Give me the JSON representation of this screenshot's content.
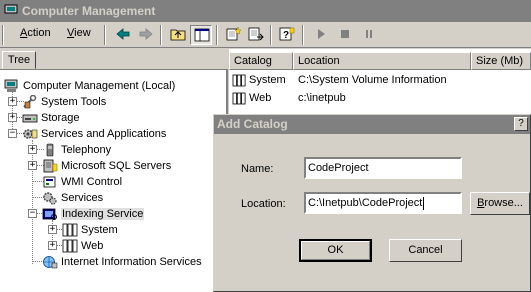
{
  "window": {
    "title": "Computer Management"
  },
  "menu": {
    "action": {
      "accel": "A",
      "rest": "ction"
    },
    "view": {
      "accel": "V",
      "rest": "iew"
    }
  },
  "toolbar": {
    "buttons": [
      "back-icon",
      "forward-icon",
      "up-folder-icon",
      "show-hide-tree-icon",
      "new-catalog-icon",
      "export-list-icon",
      "help-icon",
      "start-icon",
      "stop-icon",
      "pause-icon"
    ]
  },
  "tree": {
    "tab": "Tree",
    "nodes": {
      "root": "Computer Management (Local)",
      "system_tools": "System Tools",
      "storage": "Storage",
      "services_apps": "Services and Applications",
      "telephony": "Telephony",
      "sql": "Microsoft SQL Servers",
      "wmi": "WMI Control",
      "services": "Services",
      "indexing": "Indexing Service",
      "system": "System",
      "web": "Web",
      "iis": "Internet Information Services"
    },
    "selected": "Indexing Service"
  },
  "list": {
    "columns": [
      "Catalog",
      "Location",
      "Size (Mb)"
    ],
    "rows": [
      {
        "catalog": "System",
        "location": "C:\\System Volume Information"
      },
      {
        "catalog": "Web",
        "location": "c:\\inetpub"
      }
    ]
  },
  "dialog": {
    "title": "Add Catalog",
    "help": "?",
    "name_label": "Name:",
    "name_value": "CodeProject",
    "location_label": "Location:",
    "location_value": "C:\\Inetpub\\CodeProject",
    "browse": {
      "accel": "B",
      "rest": "rowse..."
    },
    "ok": "OK",
    "cancel": "Cancel"
  }
}
